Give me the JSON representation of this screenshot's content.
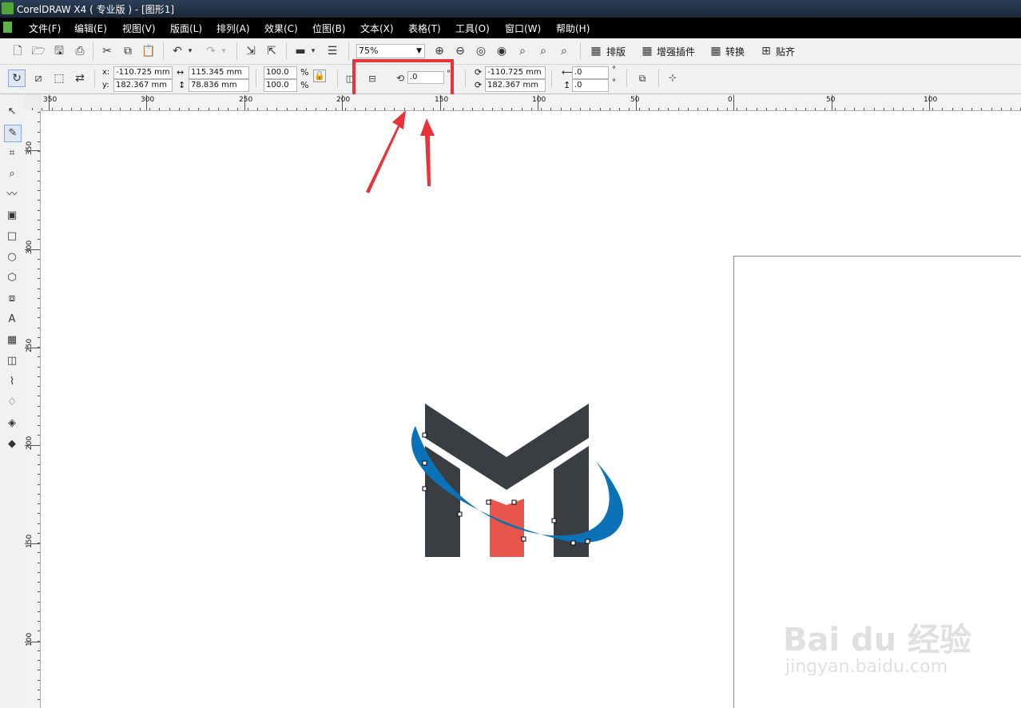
{
  "window": {
    "title": "CorelDRAW X4 ( 专业版 ) - [图形1]"
  },
  "menu": [
    "文件(F)",
    "编辑(E)",
    "视图(V)",
    "版面(L)",
    "排列(A)",
    "效果(C)",
    "位图(B)",
    "文本(X)",
    "表格(T)",
    "工具(O)",
    "窗口(W)",
    "帮助(H)"
  ],
  "toolbar1": {
    "zoom_value": "75%",
    "layout_label": "排版",
    "plugin_label": "增强插件",
    "convert_label": "转换",
    "snap_label": "贴齐"
  },
  "properties": {
    "x_label": "x:",
    "x_value": "-110.725 mm",
    "y_label": "y:",
    "y_value": "182.367 mm",
    "width_value": "115.345 mm",
    "height_value": "78.836 mm",
    "scale_x": "100.0",
    "scale_y": "100.0",
    "percent": "%",
    "rotation_value": ".0",
    "degree": "°",
    "center_x": "-110.725 mm",
    "center_y": "182.367 mm",
    "skew_h": ".0",
    "skew_v": ".0"
  },
  "ruler": {
    "horizontal": [
      "350",
      "300",
      "250",
      "200",
      "150",
      "100",
      "50",
      "0",
      "50",
      "100"
    ],
    "vertical": [
      "350",
      "300",
      "250",
      "200",
      "150",
      "100"
    ]
  },
  "watermark": {
    "brand": "Bai du 经验",
    "url": "jingyan.baidu.com"
  },
  "colors": {
    "highlight": "#e8333a",
    "logo_dark": "#3a3d41",
    "logo_red": "#e8554a",
    "logo_blue": "#0b72b8"
  }
}
